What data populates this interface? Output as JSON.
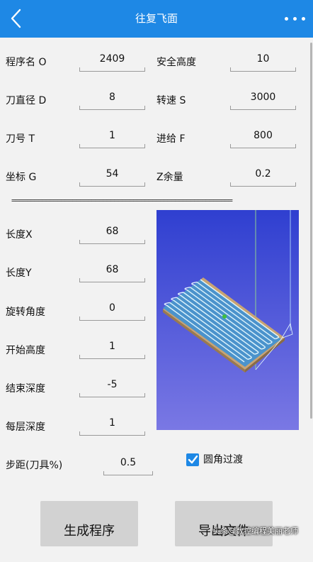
{
  "appbar": {
    "title": "往复飞面",
    "back_icon": "chevron-left-icon",
    "more_icon": "more-vert-icon",
    "color": "#1e88e5"
  },
  "params": {
    "program_name": {
      "label": "程序名 O",
      "value": "2409"
    },
    "safe_height": {
      "label": "安全高度",
      "value": "10"
    },
    "tool_diameter": {
      "label": "刀直径 D",
      "value": "8"
    },
    "spindle_speed": {
      "label": "转速 S",
      "value": "3000"
    },
    "tool_number": {
      "label": "刀号 T",
      "value": "1"
    },
    "feed": {
      "label": "进给 F",
      "value": "800"
    },
    "coordinate": {
      "label": "坐标 G",
      "value": "54"
    },
    "z_allowance": {
      "label": "Z余量",
      "value": "0.2"
    }
  },
  "divider": "==========================================================",
  "dimensions": {
    "length_x": {
      "label": "长度X",
      "value": "68"
    },
    "length_y": {
      "label": "长度Y",
      "value": "68"
    },
    "rotation": {
      "label": "旋转角度",
      "value": "0"
    },
    "start_height": {
      "label": "开始高度",
      "value": "1"
    },
    "end_depth": {
      "label": "结束深度",
      "value": "-5"
    },
    "layer_depth": {
      "label": "每层深度",
      "value": "1"
    },
    "step": {
      "label": "步距(刀具%)",
      "value": "0.5"
    }
  },
  "options": {
    "round_corner": {
      "label": "圆角过渡",
      "checked": true
    }
  },
  "actions": {
    "generate": "生成程序",
    "export": "导出文件"
  },
  "watermark": "头条@数控编程美丽老师"
}
